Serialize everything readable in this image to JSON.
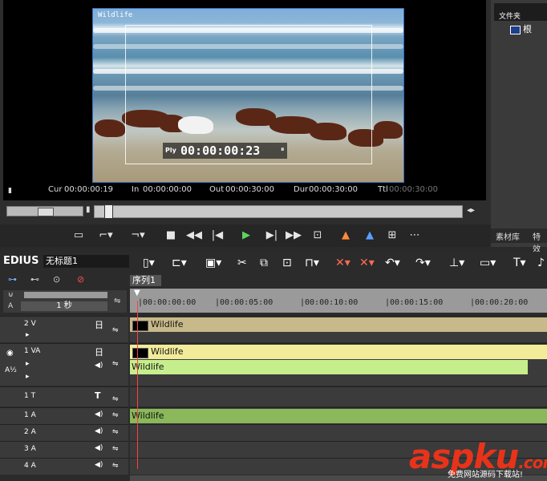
{
  "player": {
    "clip_name": "Wildlife",
    "timecode_label": "Ply",
    "timecode": "00:00:00:23",
    "cur_label": "Cur",
    "cur": "00:00:00:19",
    "in_label": "In",
    "in": "00:00:00:00",
    "out_label": "Out",
    "out": "00:00:30:00",
    "dur_label": "Dur",
    "dur": "00:00:30:00",
    "ttl_label": "Ttl",
    "ttl": "00:00:30:00"
  },
  "bin": {
    "folder_label": "文件夹",
    "root_label": "根",
    "tab_library": "素材库",
    "tab_effects": "特效"
  },
  "timeline": {
    "app_name": "EDIUS",
    "project_name": "无标题1",
    "sequence_tab": "序列1",
    "zoom_label": "1 秒",
    "ruler_labels": [
      "|00:00:00:00",
      "|00:00:05:00",
      "|00:00:10:00",
      "|00:00:15:00",
      "|00:00:20:00"
    ],
    "tracks": [
      {
        "name": "2 V",
        "clip": "Wildlife"
      },
      {
        "name": "1 VA",
        "clip": "Wildlife",
        "audio_clip": "Wildlife"
      },
      {
        "name": "1 T"
      },
      {
        "name": "1 A",
        "clip": "Wildlife"
      },
      {
        "name": "2 A"
      },
      {
        "name": "3 A"
      },
      {
        "name": "4 A"
      }
    ]
  },
  "watermark": {
    "text": "aspku",
    "suffix": ".com",
    "subtext": "免费网站源码下载站!"
  },
  "colors": {
    "accent": "#3a6dc8",
    "clip_video_tan": "#c8b98a",
    "clip_va_yellow": "#f2ec9a",
    "clip_audio_green": "#c7ee8c",
    "clip_a_green": "#8ab85a"
  }
}
